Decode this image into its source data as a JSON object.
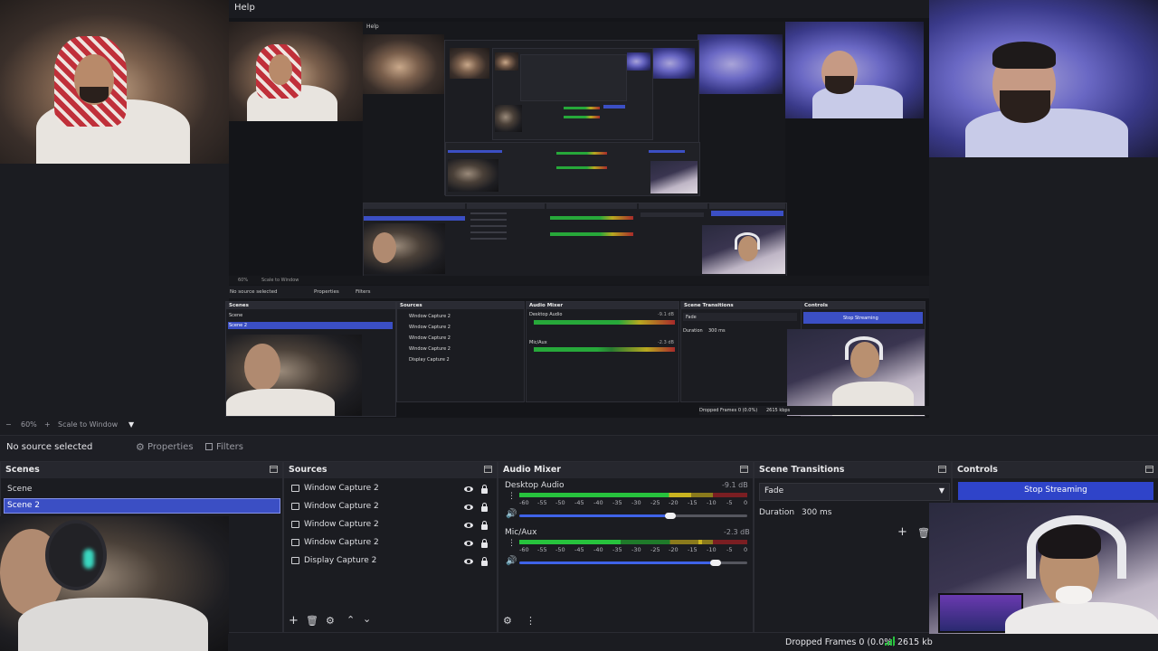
{
  "menu": {
    "help_label": "Help",
    "nested_help_label": "Help"
  },
  "toolbar": {
    "zoom_minus": "−",
    "zoom_value": "60%",
    "zoom_plus": "+",
    "scale_label": "Scale to Window",
    "scale_caret": "▼"
  },
  "source_bar": {
    "no_source": "No source selected",
    "properties_label": "Properties",
    "filters_label": "Filters"
  },
  "scenes": {
    "title": "Scenes",
    "items": [
      {
        "label": "Scene"
      },
      {
        "label": "Scene 2"
      }
    ],
    "selected_index": 1
  },
  "sources": {
    "title": "Sources",
    "items": [
      {
        "label": "Window Capture 2",
        "visible": true,
        "locked": true
      },
      {
        "label": "Window Capture 2",
        "visible": true,
        "locked": true
      },
      {
        "label": "Window Capture 2",
        "visible": true,
        "locked": true
      },
      {
        "label": "Window Capture 2",
        "visible": true,
        "locked": true
      },
      {
        "label": "Display Capture 2",
        "visible": true,
        "locked": true
      }
    ],
    "footer_icons": [
      "add-icon",
      "trash-icon",
      "gear-icon",
      "arrow-up-icon",
      "arrow-down-icon"
    ]
  },
  "audio_mixer": {
    "title": "Audio Mixer",
    "channels": [
      {
        "name": "Desktop Audio",
        "db": "-9.1 dB",
        "level_fraction": 0.75,
        "volume_fraction": 0.66
      },
      {
        "name": "Mic/Aux",
        "db": "-2.3 dB",
        "level_fraction": 0.2,
        "volume_fraction": 0.85
      }
    ],
    "ticks": [
      "-60",
      "-55",
      "-50",
      "-45",
      "-40",
      "-35",
      "-30",
      "-25",
      "-20",
      "-15",
      "-10",
      "-5",
      "0"
    ]
  },
  "transitions": {
    "title": "Scene Transitions",
    "selected": "Fade",
    "duration_label": "Duration",
    "duration_value": "300 ms"
  },
  "controls": {
    "title": "Controls",
    "stop_streaming": "Stop Streaming"
  },
  "status_bar": {
    "dropped_frames": "Dropped Frames 0 (0.0%)",
    "bitrate": "2615 kb"
  },
  "nested": {
    "no_source": "No source selected",
    "properties_label": "Properties",
    "filters_label": "Filters",
    "zoom_value": "60%",
    "scale_label": "Scale to Window",
    "scenes_title": "Scenes",
    "scene_1": "Scene",
    "scene_2": "Scene 2",
    "sources_title": "Sources",
    "source_items": [
      "Window Capture 2",
      "Window Capture 2",
      "Window Capture 2",
      "Window Capture 2",
      "Display Capture 2"
    ],
    "mixer_title": "Audio Mixer",
    "desktop_audio": "Desktop Audio",
    "mic_aux": "Mic/Aux",
    "desktop_db": "-9.1 dB",
    "mic_db": "-2.3 dB",
    "transitions_title": "Scene Transitions",
    "fade": "Fade",
    "duration_label": "Duration",
    "duration_value": "300 ms",
    "controls_title": "Controls",
    "stop_streaming": "Stop Streaming",
    "dropped_frames": "Dropped Frames 0 (0.0%)",
    "bitrate": "2615 kbps"
  },
  "colors": {
    "accent": "#2f44c9",
    "selection": "#3b4fc4",
    "meter_green": "#27c23d",
    "meter_yellow": "#c9b320",
    "meter_red": "#c42a2a",
    "panel_bg": "#1b1c21"
  }
}
